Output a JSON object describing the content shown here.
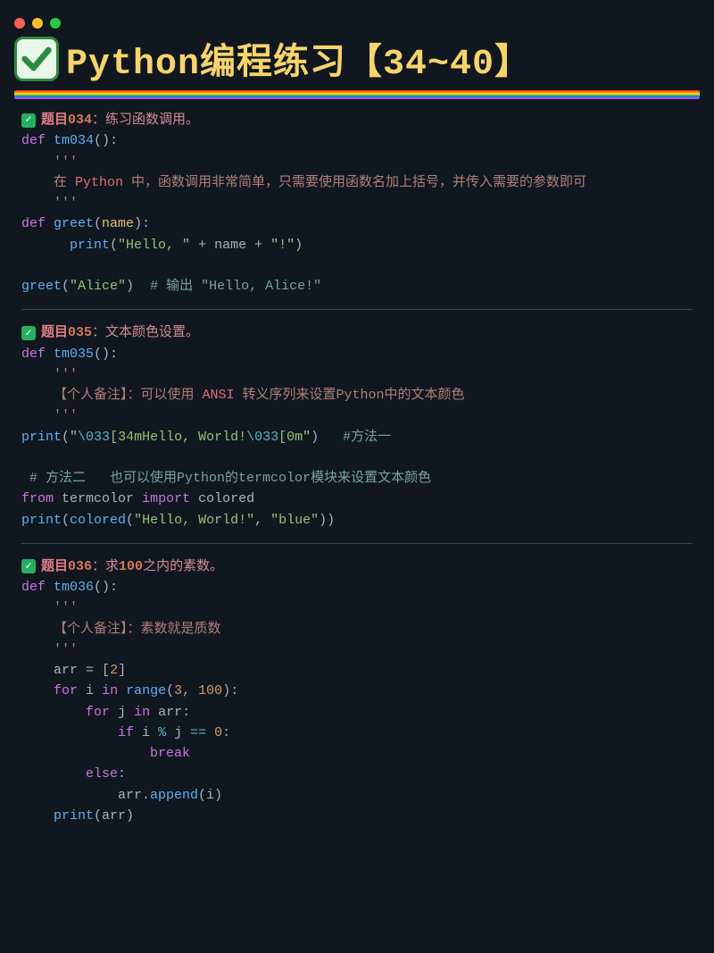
{
  "title": "Python编程练习【34~40】",
  "sections": [
    {
      "label": "题目",
      "num": "034",
      "desc": "：练习函数调用。",
      "code": {
        "def1": "tm034",
        "doc_pre": "在 ",
        "doc_hi": "Python",
        "doc_post": " 中，函数调用非常简单，只需要使用函数名加上括号，并传入需要的参数即可",
        "def2": "greet",
        "param": "name",
        "print": "print",
        "s1": "\"Hello, \"",
        "plus": " + ",
        "s2": "\"!\"",
        "call_arg": "\"Alice\"",
        "cmt": "# 输出 \"Hello, Alice!\""
      }
    },
    {
      "label": "题目",
      "num": "035",
      "desc": "：文本颜色设置。",
      "code": {
        "def1": "tm035",
        "doc_pre": "【个人备注】：可以使用 ",
        "doc_hi": "ANSI",
        "doc_post": " 转义序列来设置Python中的文本颜色",
        "print": "print",
        "s1a": "\"",
        "esc1": "\\033",
        "s1b": "[34mHello, World!",
        "esc2": "\\033",
        "s1c": "[0m\"",
        "cmt1": "#方法一",
        "cmt2_a": " # 方法二   也可以使用",
        "cmt2_b": "Python",
        "cmt2_c": "的",
        "cmt2_d": "termcolor",
        "cmt2_e": "模块来设置文本颜色",
        "from": "from",
        "mod": "termcolor",
        "import": "import",
        "colored": "colored",
        "s2": "\"Hello, World!\"",
        "s3": "\"blue\""
      }
    },
    {
      "label": "题目",
      "num": "036",
      "desc_a": "：求",
      "desc_num": "100",
      "desc_b": "之内的素数。",
      "code": {
        "def1": "tm036",
        "doc": "【个人备注】：素数就是质数",
        "arr": "arr",
        "eq": " = ",
        "lit2": "2",
        "for": "for",
        "i": "i",
        "in": "in",
        "range": "range",
        "n3": "3",
        "n100": "100",
        "j": "j",
        "if": "if",
        "mod": " % ",
        "eq0": " == ",
        "zero": "0",
        "break": "break",
        "else": "else",
        "append": "append",
        "print": "print"
      }
    }
  ]
}
